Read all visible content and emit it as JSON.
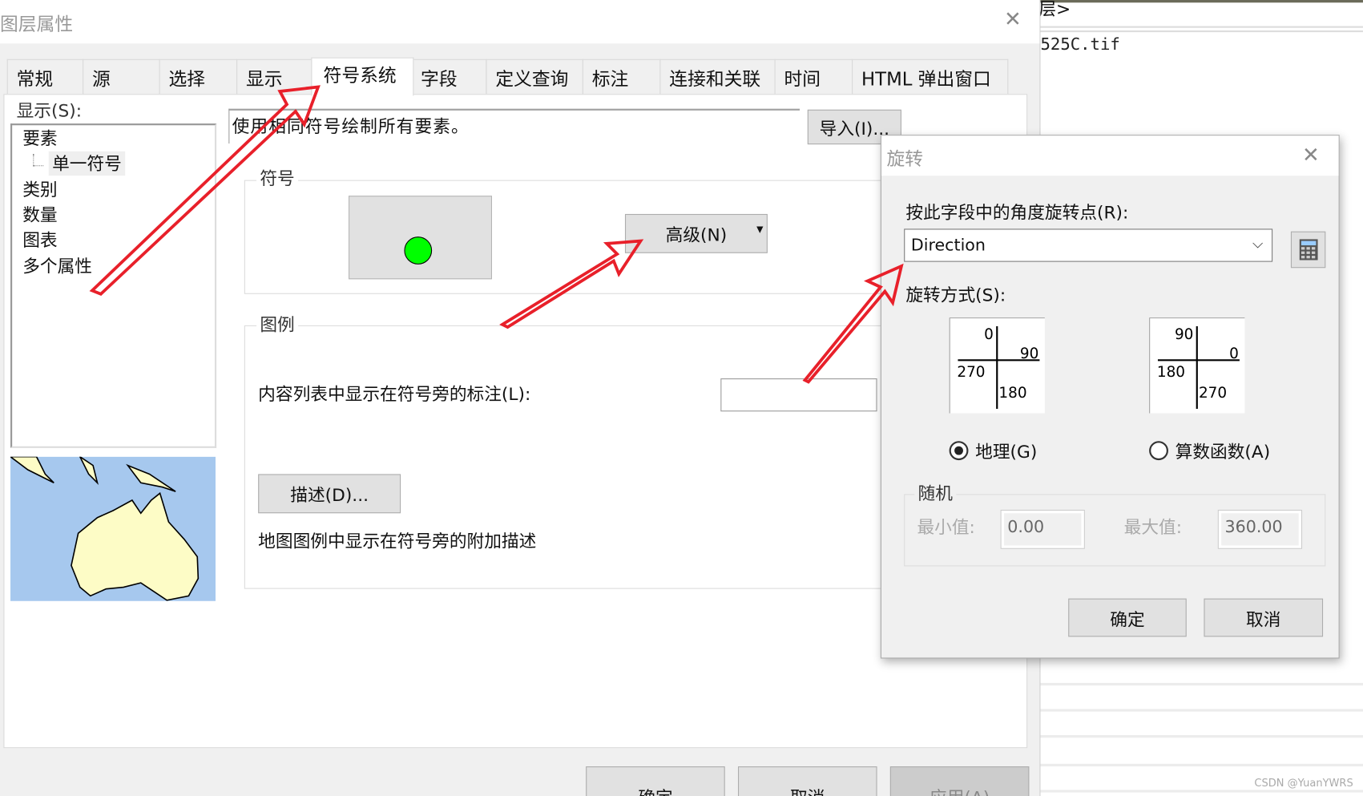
{
  "background": {
    "breadcrumb_fragment": "层>",
    "file_fragment": "525C.tif",
    "watermark": "CSDN @YuanYWRS"
  },
  "layer_properties": {
    "title": "图层属性",
    "tabs": [
      {
        "label": "常规"
      },
      {
        "label": "源"
      },
      {
        "label": "选择"
      },
      {
        "label": "显示"
      },
      {
        "label": "符号系统",
        "selected": true
      },
      {
        "label": "字段"
      },
      {
        "label": "定义查询"
      },
      {
        "label": "标注"
      },
      {
        "label": "连接和关联"
      },
      {
        "label": "时间"
      },
      {
        "label": "HTML 弹出窗口"
      }
    ],
    "show_label": "显示(S):",
    "tree": {
      "items": [
        {
          "label": "要素"
        },
        {
          "label": "单一符号",
          "child": true,
          "selected": true
        },
        {
          "label": "类别"
        },
        {
          "label": "数量"
        },
        {
          "label": "图表"
        },
        {
          "label": "多个属性"
        }
      ]
    },
    "description": "使用相同符号绘制所有要素。",
    "import_button": "导入(I)...",
    "symbol_group": {
      "label": "符号",
      "symbol_color": "#00ff00",
      "advanced_button": "高级(N)"
    },
    "legend_group": {
      "label": "图例",
      "toc_label": "内容列表中显示在符号旁的标注(L):",
      "toc_value": "",
      "describe_button": "描述(D)...",
      "describe_hint": "地图图例中显示在符号旁的附加描述"
    },
    "buttons": {
      "ok": "确定",
      "cancel": "取消",
      "apply": "应用(A)"
    }
  },
  "rotation_dialog": {
    "title": "旋转",
    "field_label": "按此字段中的角度旋转点(R):",
    "field_value": "Direction",
    "style_label": "旋转方式(S):",
    "geographic": {
      "labels": {
        "top": "0",
        "right": "90",
        "left": "270",
        "bottom": "180"
      },
      "radio": "地理(G)",
      "selected": true
    },
    "arithmetic": {
      "labels": {
        "top": "90",
        "right": "0",
        "left": "180",
        "bottom": "270"
      },
      "radio": "算数函数(A)",
      "selected": false
    },
    "random": {
      "label": "随机",
      "min_label": "最小值:",
      "min_value": "0.00",
      "max_label": "最大值:",
      "max_value": "360.00"
    },
    "ok": "确定",
    "cancel": "取消"
  },
  "annotation_color": "#e8202a"
}
